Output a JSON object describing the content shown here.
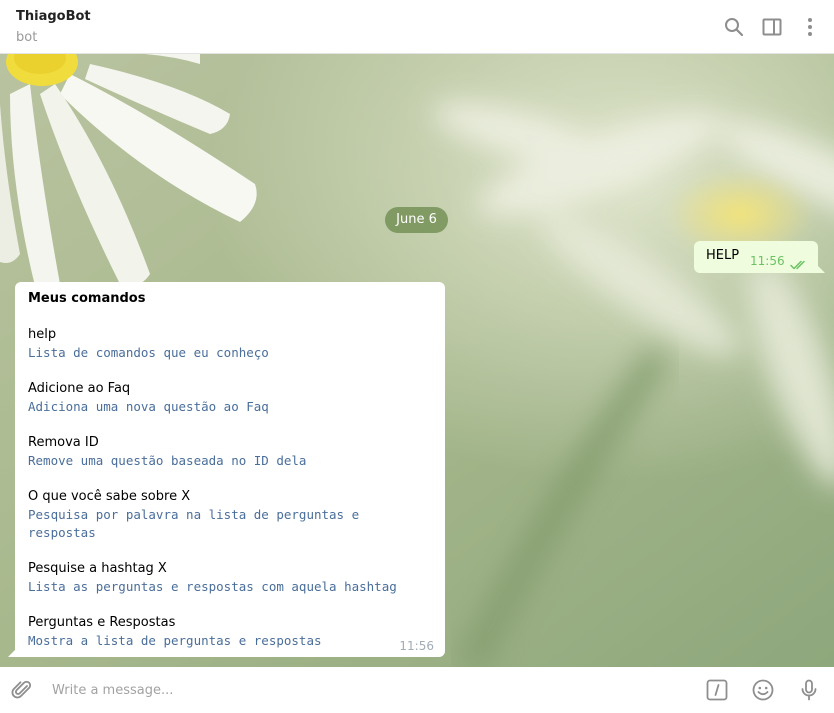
{
  "header": {
    "title": "ThiagoBot",
    "subtitle": "bot",
    "icons": [
      "search-icon",
      "sidebar-toggle-icon",
      "more-vertical-icon"
    ]
  },
  "chat": {
    "date": "June 6",
    "outgoing": {
      "text": "HELP",
      "time": "11:56",
      "status": "read-double-check"
    },
    "incoming": {
      "header": "Meus comandos",
      "commands": [
        {
          "name": "help",
          "description": "Lista de comandos que eu conheço"
        },
        {
          "name": "Adicione ao Faq",
          "description": "Adiciona uma nova questão ao Faq"
        },
        {
          "name": "Remova ID",
          "description": "Remove uma questão baseada no ID dela"
        },
        {
          "name": "O que você sabe sobre X",
          "description": "Pesquisa por palavra na lista de perguntas e respostas"
        },
        {
          "name": "Pesquise a hashtag X",
          "description": "Lista as perguntas e respostas com aquela hashtag"
        },
        {
          "name": "Perguntas e Respostas",
          "description": "Mostra a lista de perguntas e respostas"
        }
      ],
      "time": "11:56"
    }
  },
  "composer": {
    "placeholder": "Write a message...",
    "icons": [
      "attach-icon",
      "bot-command-icon",
      "emoji-icon",
      "microphone-icon"
    ]
  },
  "colors": {
    "outgoing_bubble": "#effdde",
    "incoming_bubble": "#ffffff",
    "check_color": "#6cc264",
    "monospace_text": "#4a6e9a",
    "date_pill": "#6e8c50"
  }
}
